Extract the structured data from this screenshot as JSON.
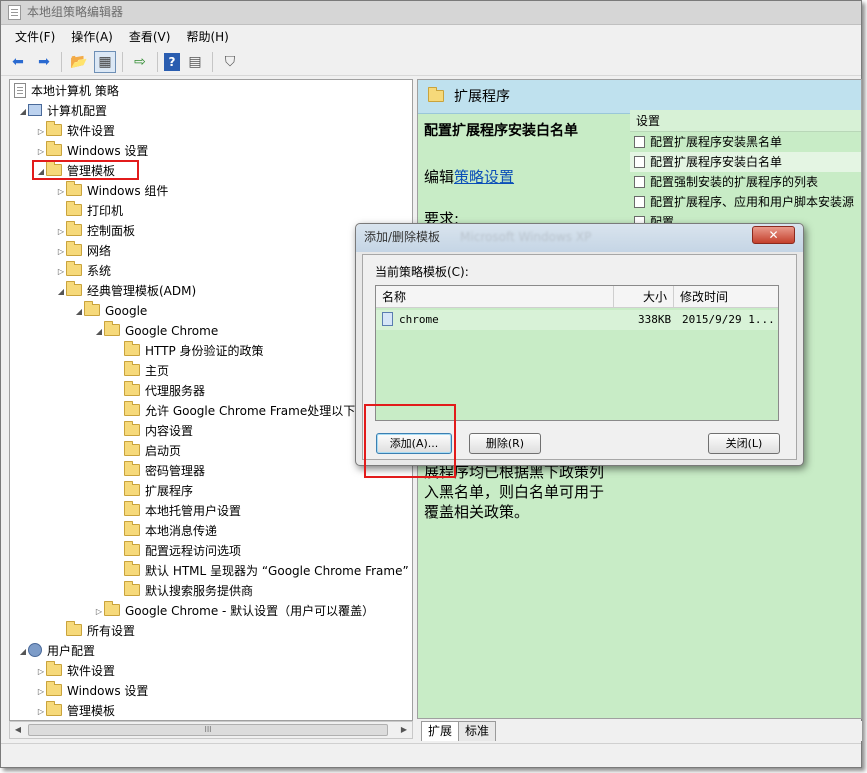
{
  "window": {
    "title": "本地组策略编辑器"
  },
  "menu": [
    "文件(F)",
    "操作(A)",
    "查看(V)",
    "帮助(H)"
  ],
  "toolbar": {
    "icons": [
      "back-arrow-icon",
      "forward-arrow-icon",
      "up-folder-icon",
      "show-hide-tree-icon",
      "export-list-icon",
      "help-icon",
      "properties-icon",
      "filter-icon"
    ],
    "glyphs": [
      "⬅",
      "➡",
      "📂",
      "▦",
      "⇨",
      "?",
      "▤",
      "⛉"
    ]
  },
  "tree": {
    "root": "本地计算机 策略",
    "computer_config": "计算机配置",
    "software_settings": "软件设置",
    "windows_settings": "Windows 设置",
    "admin_templates": "管理模板",
    "windows_components": "Windows 组件",
    "printers": "打印机",
    "control_panel": "控制面板",
    "network": "网络",
    "system": "系统",
    "classic_adm": "经典管理模板(ADM)",
    "google": "Google",
    "google_chrome": "Google Chrome",
    "chrome_children": [
      "HTTP 身份验证的政策",
      "主页",
      "代理服务器",
      "允许 Google Chrome Frame处理以下",
      "内容设置",
      "启动页",
      "密码管理器",
      "扩展程序",
      "本地托管用户设置",
      "本地消息传递",
      "配置远程访问选项",
      "默认 HTML 呈现器为 “Google Chrome Frame”",
      "默认搜索服务提供商"
    ],
    "chrome_defaults": "Google Chrome - 默认设置（用户可以覆盖）",
    "all_settings": "所有设置",
    "user_config": "用户配置",
    "user_software": "软件设置",
    "user_windows": "Windows 设置",
    "user_admin": "管理模板"
  },
  "right": {
    "header": "扩展程序",
    "policy_title": "配置扩展程序安装白名单",
    "edit_prefix": "编辑",
    "edit_link": "策略设置",
    "requirements": "要求:",
    "desc_lines": [
      "展程序均已根据黑下政策列",
      "入黑名单，则白名单可用于",
      "覆盖相关政策。"
    ],
    "settings_header": "设置",
    "settings": [
      "配置扩展程序安装黑名单",
      "配置扩展程序安装白名单",
      "配置强制安装的扩展程序的列表",
      "配置扩展程序、应用和用户脚本安装源",
      "配置"
    ],
    "tabs": [
      "扩展",
      "标准"
    ]
  },
  "dialog": {
    "title": "添加/删除模板",
    "title_blurred": "Microsoft Windows XP",
    "close": "✕",
    "label": "当前策略模板(C):",
    "columns": {
      "name": "名称",
      "size": "大小",
      "modified": "修改时间"
    },
    "rows": [
      {
        "name": "chrome",
        "size": "338KB",
        "modified": "2015/9/29 1..."
      }
    ],
    "buttons": {
      "add": "添加(A)...",
      "remove": "删除(R)",
      "close": "关闭(L)"
    }
  },
  "scroll": {
    "thumb": "III",
    "left": "◀",
    "right": "▶"
  }
}
